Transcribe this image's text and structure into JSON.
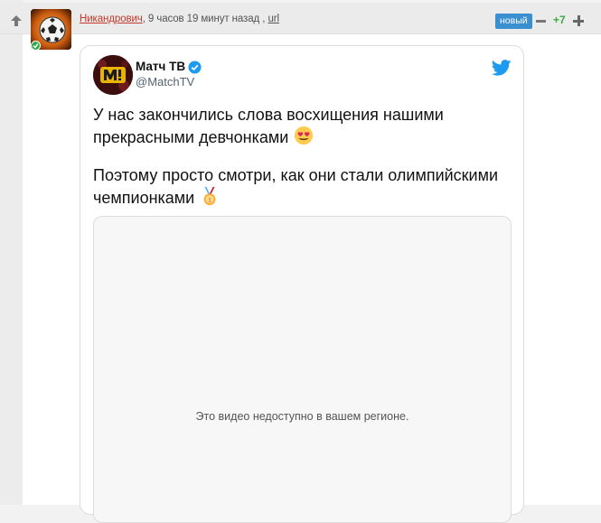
{
  "comment": {
    "author": "Никандрович",
    "separator": ",",
    "time": "9 часов 19 минут назад ,",
    "link": "url",
    "badge": "новый",
    "rating": "+7"
  },
  "tweet": {
    "name": "Матч ТВ",
    "handle": "@MatchTV",
    "paragraph1": "У нас закончились слова восхищения нашими прекрасными девчонками",
    "paragraph2": "Поэтому просто смотри, как они стали олимпийскими чемпионками",
    "emoji1_icon": "heart-eyes-emoji",
    "emoji2_icon": "gold-medal-emoji",
    "video_message": "Это видео недоступно в вашем регионе."
  },
  "colors": {
    "author": "#c0392b",
    "badge": "#3a8fd1",
    "rating": "#3aab3a",
    "twitter_blue": "#1d9bf0"
  }
}
